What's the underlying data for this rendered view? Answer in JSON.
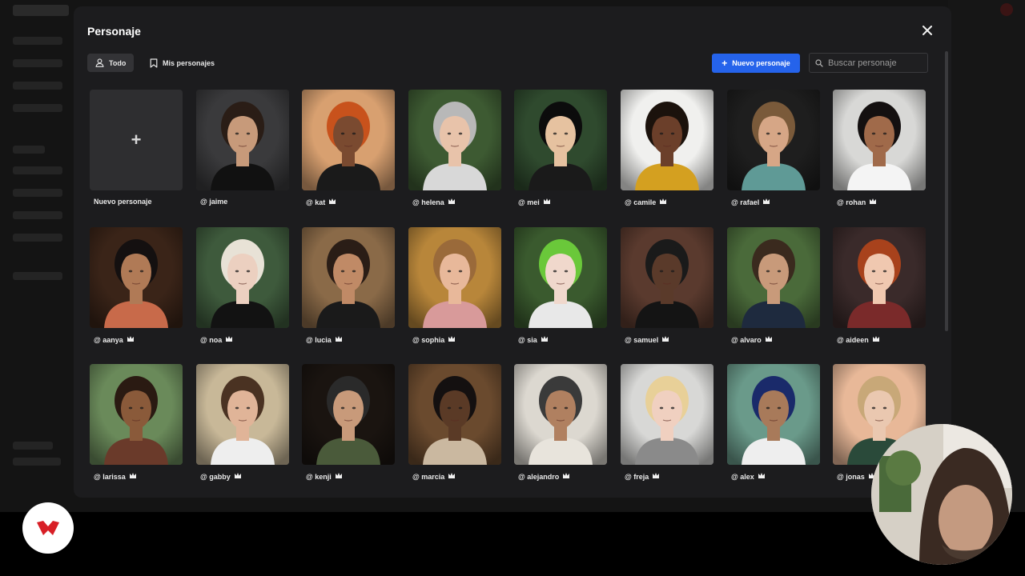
{
  "modal": {
    "title": "Personaje",
    "tabs": [
      {
        "label": "Todo",
        "icon": "user-icon",
        "active": true
      },
      {
        "label": "Mis personajes",
        "icon": "bookmark-icon",
        "active": false
      }
    ],
    "new_button_label": "Nuevo personaje",
    "search_placeholder": "Buscar personaje"
  },
  "new_card_label": "Nuevo personaje",
  "characters": [
    {
      "handle": "@ jaime",
      "premium": false,
      "bg": "#3a3a3c",
      "skin": "#c79a7a",
      "hair": "#2a1d16",
      "shirt": "#111111"
    },
    {
      "handle": "@ kat",
      "premium": true,
      "bg": "#d8a070",
      "skin": "#7a4a30",
      "hair": "#c8521c",
      "shirt": "#1a1a1a"
    },
    {
      "handle": "@ helena",
      "premium": true,
      "bg": "#3d5a32",
      "skin": "#e8c3aa",
      "hair": "#b8b8b8",
      "shirt": "#d8d8d8"
    },
    {
      "handle": "@ mei",
      "premium": true,
      "bg": "#2f4a2e",
      "skin": "#e6c2a0",
      "hair": "#0c0c0c",
      "shirt": "#1a1a1a"
    },
    {
      "handle": "@ camile",
      "premium": true,
      "bg": "#f0f0ee",
      "skin": "#6b3f2a",
      "hair": "#1b120c",
      "shirt": "#d4a020"
    },
    {
      "handle": "@ rafael",
      "premium": true,
      "bg": "#1e1e1e",
      "skin": "#d6a686",
      "hair": "#7a5a3a",
      "shirt": "#5f9a96"
    },
    {
      "handle": "@ rohan",
      "premium": true,
      "bg": "#d8d8d6",
      "skin": "#a06a4a",
      "hair": "#141010",
      "shirt": "#f4f4f4"
    },
    {
      "handle": "@ aanya",
      "premium": true,
      "bg": "#3a2418",
      "skin": "#b07a56",
      "hair": "#141010",
      "shirt": "#c86a4a"
    },
    {
      "handle": "@ noa",
      "premium": true,
      "bg": "#3e5a3c",
      "skin": "#ecd0c0",
      "hair": "#e8e2d6",
      "shirt": "#121212"
    },
    {
      "handle": "@ lucia",
      "premium": true,
      "bg": "#8a6a48",
      "skin": "#c08a66",
      "hair": "#2a1d16",
      "shirt": "#1a1a1a"
    },
    {
      "handle": "@ sophia",
      "premium": true,
      "bg": "#b8863a",
      "skin": "#e8b89a",
      "hair": "#9a6a3a",
      "shirt": "#d89a9a"
    },
    {
      "handle": "@ sia",
      "premium": true,
      "bg": "#3a5a2e",
      "skin": "#f0d8cc",
      "hair": "#6ac83a",
      "shirt": "#e8e8e8"
    },
    {
      "handle": "@ samuel",
      "premium": true,
      "bg": "#5a3a2e",
      "skin": "#5a3a2a",
      "hair": "#1a1a1a",
      "shirt": "#141414"
    },
    {
      "handle": "@ alvaro",
      "premium": true,
      "bg": "#4a6a3a",
      "skin": "#c89a7a",
      "hair": "#3a2a1e",
      "shirt": "#1e2a3e"
    },
    {
      "handle": "@ aideen",
      "premium": true,
      "bg": "#3a2a2a",
      "skin": "#f0c8b0",
      "hair": "#a8421c",
      "shirt": "#7a2a2a"
    },
    {
      "handle": "@ larissa",
      "premium": true,
      "bg": "#6a8a5a",
      "skin": "#8a5a3a",
      "hair": "#2a1a12",
      "shirt": "#6a3a2a"
    },
    {
      "handle": "@ gabby",
      "premium": true,
      "bg": "#c8b898",
      "skin": "#e0b498",
      "hair": "#4a3222",
      "shirt": "#eeeeee"
    },
    {
      "handle": "@ kenji",
      "premium": true,
      "bg": "#1a1410",
      "skin": "#c89a7a",
      "hair": "#2a2a2a",
      "shirt": "#4a5a3a"
    },
    {
      "handle": "@ marcia",
      "premium": true,
      "bg": "#6a4a2e",
      "skin": "#5a3a26",
      "hair": "#141010",
      "shirt": "#cab8a0"
    },
    {
      "handle": "@ alejandro",
      "premium": true,
      "bg": "#dcd8d0",
      "skin": "#b08060",
      "hair": "#3a3a3a",
      "shirt": "#e8e4dc"
    },
    {
      "handle": "@ freja",
      "premium": true,
      "bg": "#d8d8d6",
      "skin": "#f0d0c0",
      "hair": "#e8d098",
      "shirt": "#8a8a8a"
    },
    {
      "handle": "@ alex",
      "premium": true,
      "bg": "#6a9a8a",
      "skin": "#a87a5a",
      "hair": "#1a2a6a",
      "shirt": "#eeeeee"
    },
    {
      "handle": "@ jonas",
      "premium": true,
      "bg": "#e8b898",
      "skin": "#eac8b0",
      "hair": "#c8a878",
      "shirt": "#2a4a3a"
    }
  ],
  "colors": {
    "accent": "#2563eb",
    "modal_bg": "#1c1c1e",
    "active_tab": "#333336"
  }
}
